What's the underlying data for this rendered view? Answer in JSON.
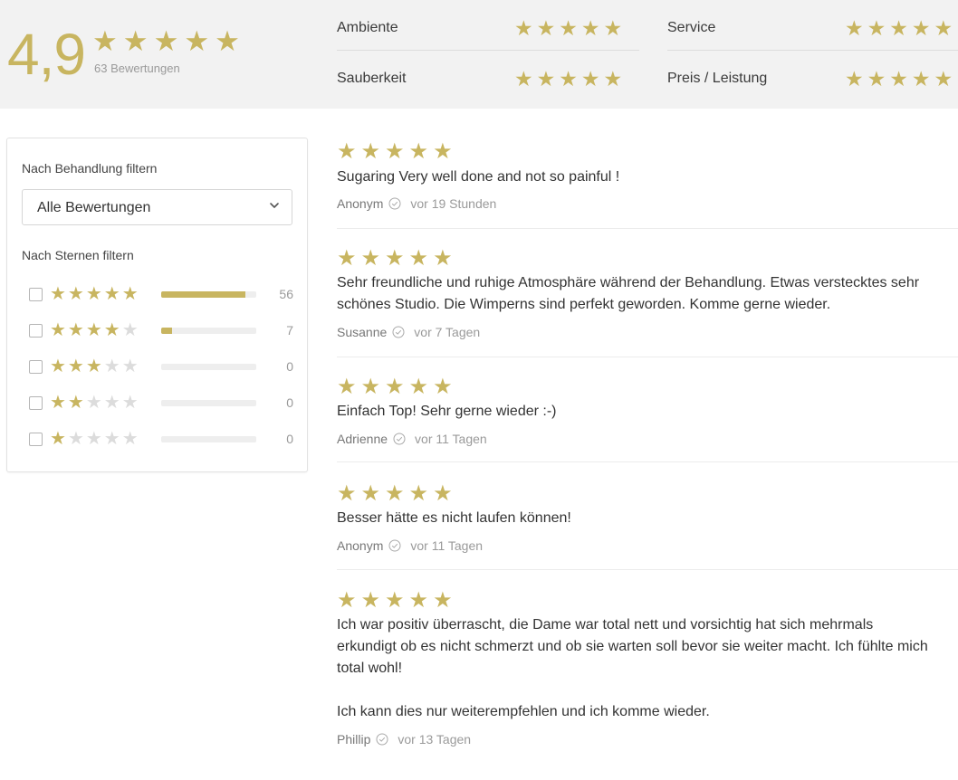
{
  "summary": {
    "score": "4,9",
    "stars": "★★★★★",
    "count": "63 Bewertungen",
    "categories": [
      {
        "label": "Ambiente",
        "stars": "★★★★★"
      },
      {
        "label": "Service",
        "stars": "★★★★★"
      },
      {
        "label": "Sauberkeit",
        "stars": "★★★★★"
      },
      {
        "label": "Preis / Leistung",
        "stars": "★★★★★"
      }
    ]
  },
  "filter": {
    "treatment_heading": "Nach Behandlung filtern",
    "select_value": "Alle Bewertungen",
    "stars_heading": "Nach Sternen filtern",
    "rows": [
      {
        "stars": 5,
        "filled": "★★★★★",
        "empty": "",
        "count": "56",
        "fraction": 0.889
      },
      {
        "stars": 4,
        "filled": "★★★★",
        "empty": "★",
        "count": "7",
        "fraction": 0.111
      },
      {
        "stars": 3,
        "filled": "★★★",
        "empty": "★★",
        "count": "0",
        "fraction": 0
      },
      {
        "stars": 2,
        "filled": "★★",
        "empty": "★★★",
        "count": "0",
        "fraction": 0
      },
      {
        "stars": 1,
        "filled": "★",
        "empty": "★★★★",
        "count": "0",
        "fraction": 0
      }
    ]
  },
  "reviews": [
    {
      "stars": "★★★★★",
      "text": "Sugaring Very well done and not so painful !",
      "author": "Anonym",
      "when": "vor 19 Stunden"
    },
    {
      "stars": "★★★★★",
      "text": "Sehr freundliche und ruhige Atmosphäre während der Behandlung. Etwas verstecktes sehr\nschönes Studio. Die Wimperns sind perfekt geworden. Komme gerne wieder.",
      "author": "Susanne",
      "when": "vor 7 Tagen"
    },
    {
      "stars": "★★★★★",
      "text": "Einfach Top! Sehr gerne wieder :-)",
      "author": "Adrienne",
      "when": "vor 11 Tagen"
    },
    {
      "stars": "★★★★★",
      "text": "Besser hätte es nicht laufen können!",
      "author": "Anonym",
      "when": "vor 11 Tagen"
    },
    {
      "stars": "★★★★★",
      "text": "Ich war positiv überrascht, die Dame war total nett und vorsichtig hat sich mehrmals\nerkundigt ob es nicht schmerzt und ob sie warten soll bevor sie weiter macht. Ich fühlte mich\ntotal wohl!\n\nIch kann dies nur weiterempfehlen und ich komme wieder.",
      "author": "Phillip",
      "when": "vor 13 Tagen"
    }
  ],
  "colors": {
    "accent": "#c8b560",
    "empty_star": "#dcdcdc",
    "header_bg": "#f2f2f2"
  },
  "icons": {
    "verified": "check-circle-icon",
    "dropdown": "chevron-down-icon",
    "star": "star-icon"
  }
}
